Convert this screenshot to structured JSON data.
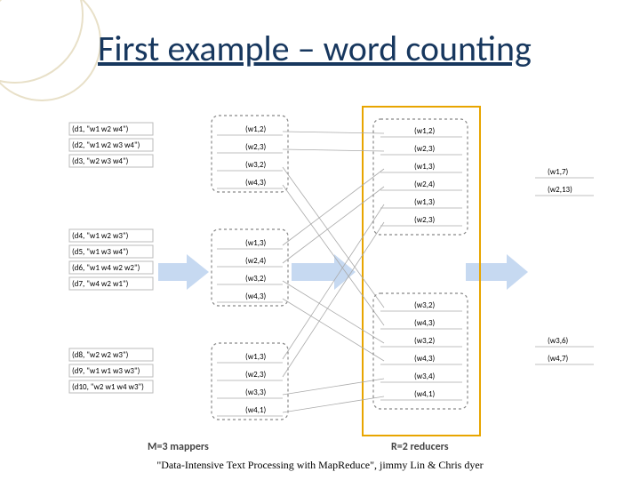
{
  "title": "First example – word counting",
  "captions": {
    "mappers": "M=3 mappers",
    "reducers": "R=2 reducers"
  },
  "citation": "\"Data-Intensive Text Processing with MapReduce\", jimmy Lin & Chris dyer",
  "input_docs": [
    [
      "(d1, \"w1 w2 w4\")",
      "(d2, \"w1 w2 w3 w4\")",
      "(d3, \"w2 w3 w4\")"
    ],
    [
      "(d4, \"w1 w2 w3\")",
      "(d5, \"w1 w3 w4\")",
      "(d6, \"w1 w4 w2 w2\")",
      "(d7, \"w4 w2 w1\")"
    ],
    [
      "(d8, \"w2 w2 w3\")",
      "(d9, \"w1 w1 w3 w3\")",
      "(d10, \"w2 w1 w4 w3\")"
    ]
  ],
  "mapper_out": [
    [
      "(w1,2)",
      "(w2,3)",
      "(w3,2)",
      "(w4,3)"
    ],
    [
      "(w1,3)",
      "(w2,4)",
      "(w3,2)",
      "(w4,3)"
    ],
    [
      "(w1,3)",
      "(w2,3)",
      "(w3,3)",
      "(w4,1)"
    ]
  ],
  "reducer_in": [
    [
      "(w1,2)",
      "(w2,3)",
      "(w1,3)",
      "(w2,4)",
      "(w1,3)",
      "(w2,3)"
    ],
    [
      "(w3,2)",
      "(w4,3)",
      "(w3,2)",
      "(w4,3)",
      "(w3,4)",
      "(w4,1)"
    ]
  ],
  "reducer_out": [
    [
      "(w1,7)",
      "(w2,13)"
    ],
    [
      "(w3,6)",
      "(w4,7)"
    ]
  ],
  "chart_data": {
    "type": "diagram",
    "stages": [
      "documents",
      "mapper-output",
      "reducer-input",
      "reducer-output"
    ],
    "mapper_count": 3,
    "reducer_count": 2
  }
}
